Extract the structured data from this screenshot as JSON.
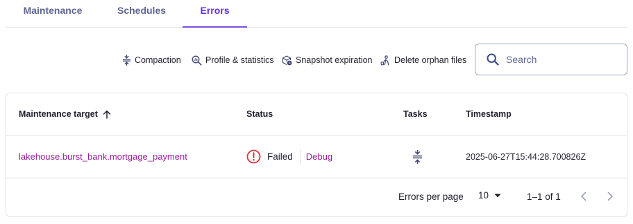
{
  "tabs": [
    {
      "label": "Maintenance"
    },
    {
      "label": "Schedules"
    },
    {
      "label": "Errors"
    }
  ],
  "active_tab": "Errors",
  "toolbar": {
    "compaction": "Compaction",
    "profile": "Profile & statistics",
    "snapshot": "Snapshot expiration",
    "orphan": "Delete orphan files",
    "search_placeholder": "Search"
  },
  "table": {
    "columns": [
      "Maintenance target",
      "Status",
      "Tasks",
      "Timestamp"
    ],
    "sort_column": "Maintenance target",
    "sort_direction": "ascending",
    "rows": [
      {
        "target": "lakehouse.burst_bank.mortgage_payment",
        "status": "Failed",
        "status_icon": "alert-circle-icon",
        "debug": "Debug",
        "task_icon": "compaction-icon",
        "timestamp": "2025-06-27T15:44:28.700826Z"
      }
    ]
  },
  "pagination": {
    "label": "Errors per page",
    "per_page": "10",
    "range": "1–1 of 1"
  },
  "colors": {
    "accent": "#6530e6",
    "link": "#9b1f9b",
    "error": "#d8343f",
    "tab_inactive": "#5d6593"
  }
}
